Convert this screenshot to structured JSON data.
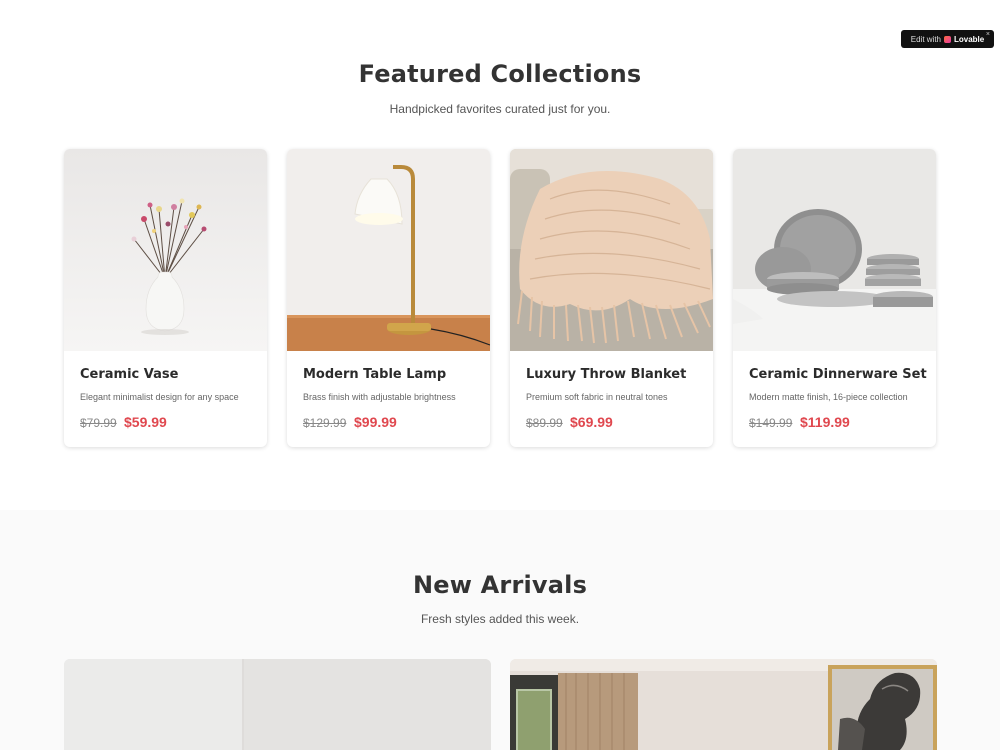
{
  "badge": {
    "edit": "Edit with",
    "brand": "Lovable",
    "close": "×"
  },
  "featured": {
    "title": "Featured Collections",
    "subtitle": "Handpicked favorites curated just for you.",
    "products": [
      {
        "name": "Ceramic Vase",
        "description": "Elegant minimalist design for any space",
        "old_price": "$79.99",
        "price": "$59.99",
        "image_icon": "vase-image"
      },
      {
        "name": "Modern Table Lamp",
        "description": "Brass finish with adjustable brightness",
        "old_price": "$129.99",
        "price": "$99.99",
        "image_icon": "lamp-image"
      },
      {
        "name": "Luxury Throw Blanket",
        "description": "Premium soft fabric in neutral tones",
        "old_price": "$89.99",
        "price": "$69.99",
        "image_icon": "blanket-image"
      },
      {
        "name": "Ceramic Dinnerware Set",
        "description": "Modern matte finish, 16-piece collection",
        "old_price": "$149.99",
        "price": "$119.99",
        "image_icon": "dinnerware-image"
      }
    ]
  },
  "arrivals": {
    "title": "New Arrivals",
    "subtitle": "Fresh styles added this week.",
    "items": [
      {
        "image_icon": "interior-wall-image"
      },
      {
        "image_icon": "bedroom-art-image"
      }
    ]
  },
  "colors": {
    "sale_price": "#e0484f",
    "section_band": "#fafafa"
  }
}
